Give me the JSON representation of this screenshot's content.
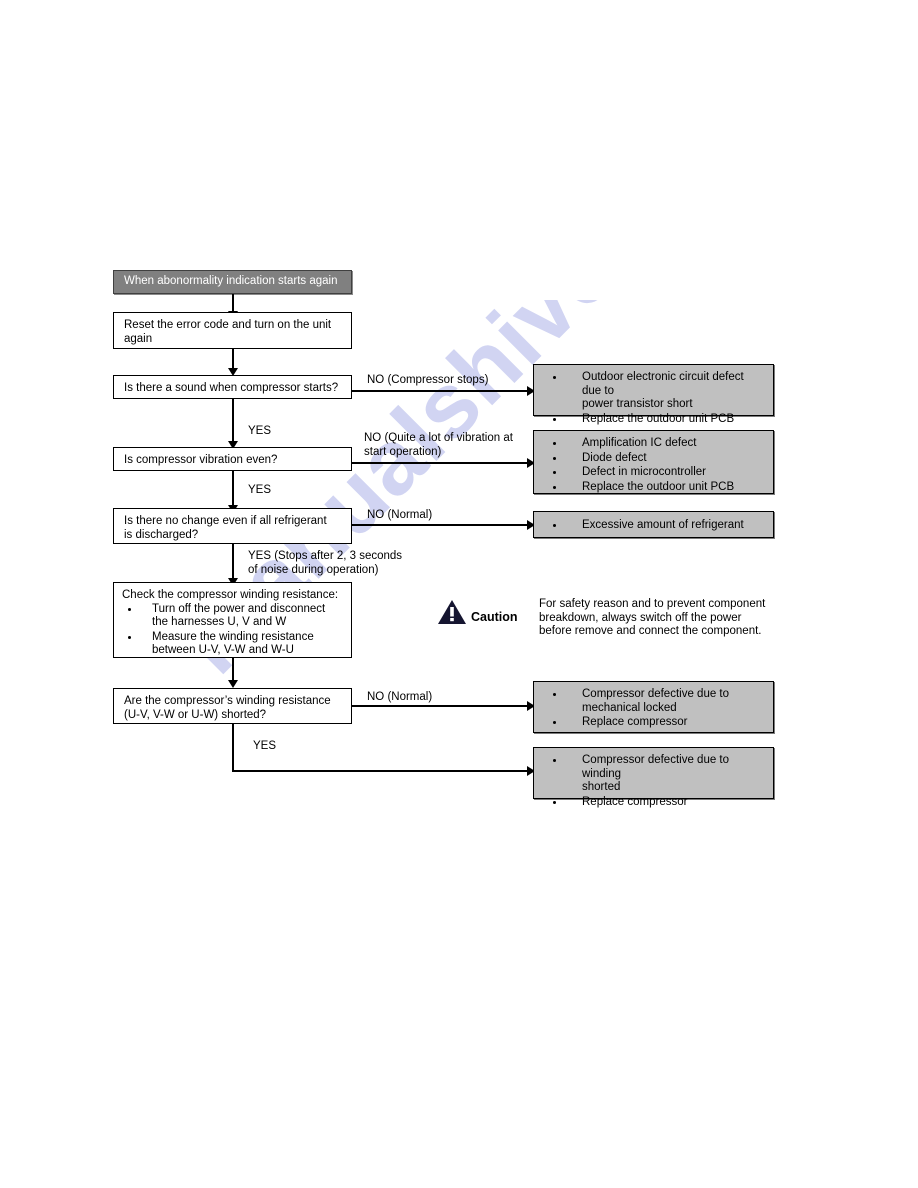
{
  "document": {
    "type": "troubleshooting-flowchart",
    "watermark": "manualshive.com"
  },
  "flow": {
    "header": {
      "label": "When abonormality indication starts again"
    },
    "steps": [
      {
        "id": "reset",
        "lines": [
          "Reset the error code and turn on the unit",
          "again"
        ]
      },
      {
        "id": "sound",
        "lines": [
          "Is there a sound when compressor starts?"
        ]
      },
      {
        "id": "vibration",
        "lines": [
          "Is compressor vibration even?"
        ]
      },
      {
        "id": "refrigerant",
        "lines": [
          "Is there no change even if all refrigerant",
          "is discharged?"
        ]
      },
      {
        "id": "winding-shorted",
        "lines": [
          "Are the compressor’s winding resistance",
          "(U-V, V-W or U-W) shorted?"
        ]
      }
    ],
    "check_box": {
      "title": "Check the compressor winding resistance:",
      "items": [
        {
          "line1": "Turn off the power and disconnect",
          "line2": "the harnesses U, V and W"
        },
        {
          "line1": "Measure the winding resistance",
          "line2": "between U-V, V-W and W-U"
        }
      ]
    },
    "edge_labels": {
      "no_compressor_stops": "NO (Compressor stops)",
      "yes_1": "YES",
      "no_vibration": "NO (Quite a lot of vibration at\nstart operation)",
      "yes_2": "YES",
      "no_normal_1": "NO (Normal)",
      "yes_stops": "YES (Stops after 2, 3 seconds\nof noise during operation)",
      "no_normal_2": "NO (Normal)",
      "yes_3": "YES"
    },
    "results": [
      {
        "id": "result-transistor",
        "items": [
          {
            "line1": "Outdoor electronic circuit defect due to",
            "line2": "power transistor short"
          },
          {
            "line1": "Replace the outdoor unit PCB",
            "line2": ""
          }
        ]
      },
      {
        "id": "result-ic",
        "items": [
          {
            "line1": "Amplification IC defect",
            "line2": ""
          },
          {
            "line1": "Diode defect",
            "line2": ""
          },
          {
            "line1": "Defect in microcontroller",
            "line2": ""
          },
          {
            "line1": "Replace the outdoor unit PCB",
            "line2": ""
          }
        ]
      },
      {
        "id": "result-refrigerant",
        "items": [
          {
            "line1": "Excessive amount of refrigerant",
            "line2": ""
          }
        ]
      },
      {
        "id": "result-mechanical",
        "items": [
          {
            "line1": "Compressor defective due to",
            "line2": "mechanical locked"
          },
          {
            "line1": "Replace compressor",
            "line2": ""
          }
        ]
      },
      {
        "id": "result-winding",
        "items": [
          {
            "line1": "Compressor defective due to winding",
            "line2": "shorted"
          },
          {
            "line1": "Replace compressor",
            "line2": ""
          }
        ]
      }
    ],
    "caution": {
      "word": "Caution",
      "lines": [
        "For safety reason and to prevent component",
        "breakdown, always switch off the power",
        "before remove and connect the component."
      ]
    }
  },
  "colors": {
    "header_fill": "#808080",
    "result_fill": "#c0c0c0",
    "box_border": "#000000",
    "watermark": "#c9cdf0",
    "caution_icon": "#1a1a33"
  }
}
